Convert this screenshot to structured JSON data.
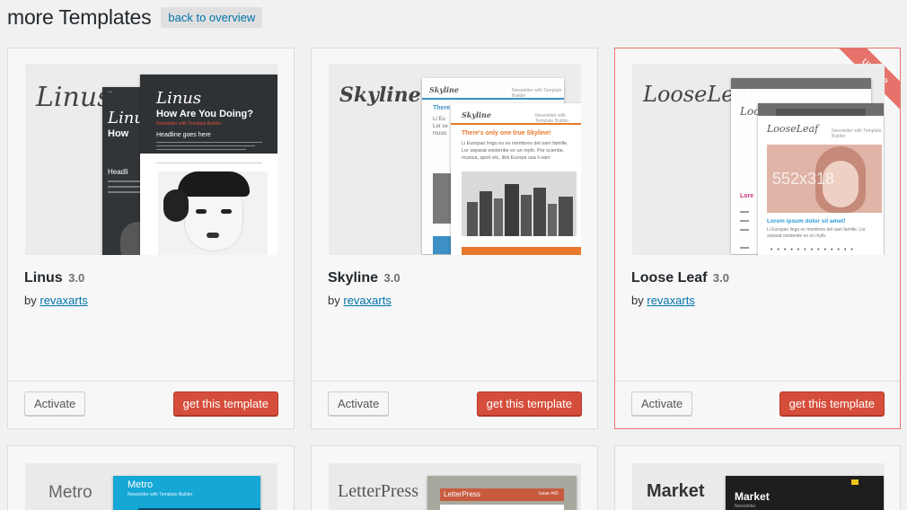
{
  "header": {
    "title": "more Templates",
    "back_label": "back to overview"
  },
  "templates": [
    {
      "name": "Linus",
      "version": "3.0",
      "by": "by",
      "author": "revaxarts",
      "activate": "Activate",
      "get": "get this template",
      "logo": "Linus",
      "preview": {
        "headline1": "Linus",
        "headline2": "How Are You Doing?",
        "sub": "Newsletter with Template Builder",
        "headline3": "Headline goes here",
        "back_t1": "Linu",
        "back_t2": "How",
        "back_t3": "Headli"
      }
    },
    {
      "name": "Skyline",
      "version": "3.0",
      "by": "by",
      "author": "revaxarts",
      "activate": "Activate",
      "get": "get this template",
      "logo": "Skyline",
      "preview": {
        "brand": "Skyline",
        "tag": "Newsletter with Template Builder",
        "headline": "There's only one true Skyline!",
        "body": "Li Europan lingu es es membres del sam familie. Lor separat existentie es un myth. Por scientie, musica, sport etc, litot Europa usa li sam",
        "back_head": "There",
        "back_body": "Li Eu Lor se music"
      }
    },
    {
      "name": "Loose Leaf",
      "version": "3.0",
      "by": "by",
      "author": "revaxarts",
      "activate": "Activate",
      "get": "get this template",
      "logo": "LooseLeaf",
      "ribbon": "update",
      "preview": {
        "brand": "LooseLeaf",
        "tag": "Newsletter with Template Builder",
        "dims": "552x318",
        "headline": "Lorem ipsum dolor sit amet!",
        "body": "Li Europan lingu es membres del sam familie. Lor separat existentie es un myth.",
        "back_brand": "Loo",
        "back_head": "Lore"
      }
    }
  ],
  "row2": [
    {
      "logo": "Metro",
      "preview_title": "Metro",
      "preview_sub": "Newsletter with Template Builder"
    },
    {
      "logo": "LetterPress",
      "preview_title": "LetterPress",
      "preview_sub": "Issue #42"
    },
    {
      "logo": "Market",
      "preview_title": "Market",
      "preview_sub": "Newsletter"
    }
  ],
  "colors": {
    "accent_red": "#d54e3b",
    "link_blue": "#0073aa",
    "highlight_border": "#e6736b"
  }
}
